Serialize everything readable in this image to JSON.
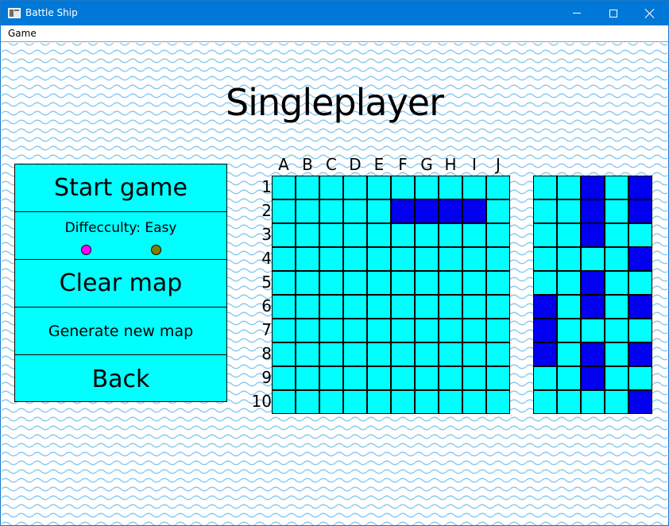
{
  "window": {
    "title": "Battle Ship",
    "icon": "app-window-icon"
  },
  "menubar": {
    "items": [
      "Game"
    ]
  },
  "page": {
    "title": "Singleplayer"
  },
  "menu": {
    "start_label": "Start game",
    "difficulty_label": "Diffecculty: Easy",
    "difficulty_colors": [
      "#ff00ff",
      "#808000"
    ],
    "clear_label": "Clear map",
    "generate_label": "Generate new map",
    "back_label": "Back"
  },
  "board": {
    "columns": [
      "A",
      "B",
      "C",
      "D",
      "E",
      "F",
      "G",
      "H",
      "I",
      "J"
    ],
    "rows": [
      "1",
      "2",
      "3",
      "4",
      "5",
      "6",
      "7",
      "8",
      "9",
      "10"
    ],
    "water_color": "#00ffff",
    "ship_color": "#0000ee",
    "ship_cells": [
      [
        1,
        5
      ],
      [
        1,
        6
      ],
      [
        1,
        7
      ],
      [
        1,
        8
      ]
    ]
  },
  "side_board": {
    "columns_count": 5,
    "rows_count": 10,
    "ship_cells": [
      [
        0,
        2
      ],
      [
        0,
        4
      ],
      [
        1,
        2
      ],
      [
        1,
        4
      ],
      [
        2,
        2
      ],
      [
        3,
        4
      ],
      [
        4,
        2
      ],
      [
        5,
        0
      ],
      [
        5,
        2
      ],
      [
        5,
        4
      ],
      [
        6,
        0
      ],
      [
        7,
        0
      ],
      [
        7,
        2
      ],
      [
        7,
        4
      ],
      [
        8,
        2
      ],
      [
        9,
        4
      ]
    ]
  },
  "colors": {
    "titlebar": "#0078d7",
    "wave": "#87c9f0"
  }
}
